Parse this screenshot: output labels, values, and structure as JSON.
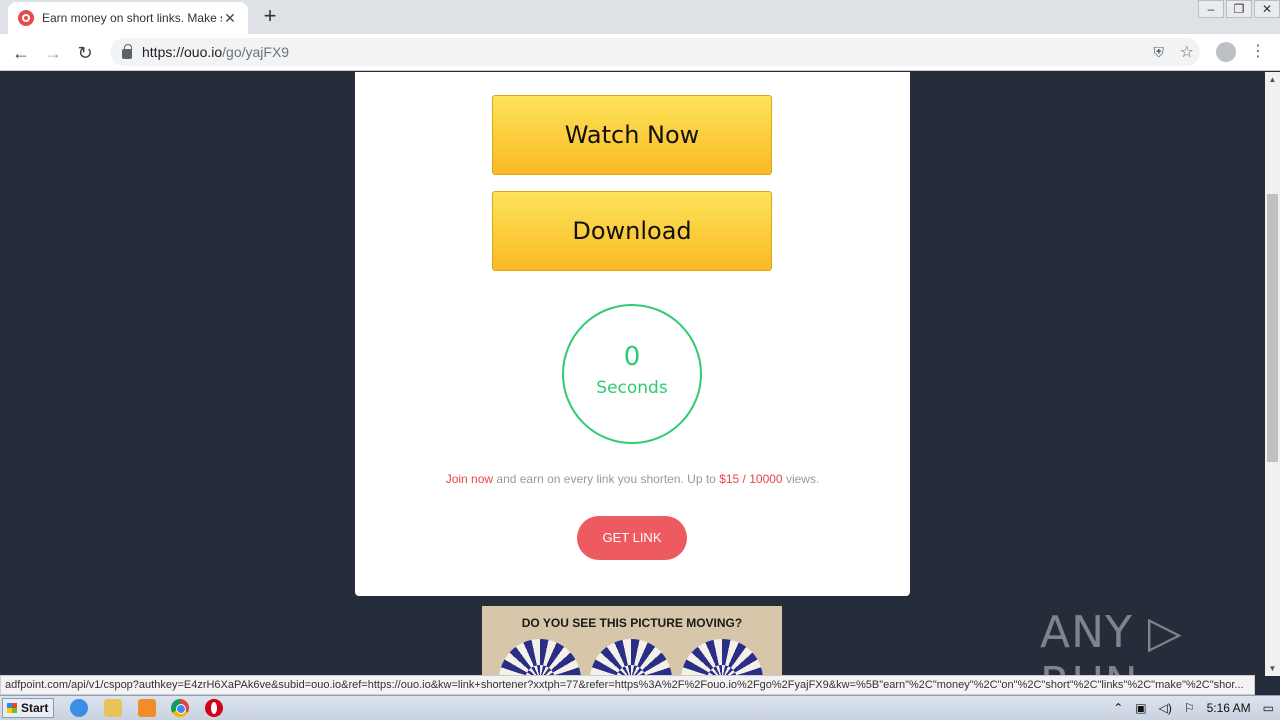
{
  "browser": {
    "tab_title": "Earn money on short links. Make sho",
    "tab_close": "✕",
    "new_tab": "+",
    "url_host": "https://ouo.io",
    "url_path": "/go/yajFX9",
    "window_controls": [
      "–",
      "❐",
      "✕"
    ]
  },
  "page": {
    "watch_now_label": "Watch Now",
    "download_label": "Download",
    "countdown_value": "0",
    "countdown_unit": "Seconds",
    "promo_join": "Join now",
    "promo_mid": " and earn on every link you shorten. Up to ",
    "promo_amount": "$15 / 10000",
    "promo_end": " views.",
    "get_link_label": "GET LINK",
    "ad_question": "DO YOU SEE THIS PICTURE MOVING?"
  },
  "watermark": "ANY ▷ RUN",
  "status_url": "adfpoint.com/api/v1/cspop?authkey=E4zrH6XaPAk6ve&subid=ouo.io&ref=https://ouo.io&kw=link+shortener?xxtph=77&refer=https%3A%2F%2Fouo.io%2Fgo%2FyajFX9&kw=%5B\"earn\"%2C\"money\"%2C\"on\"%2C\"short\"%2C\"links\"%2C\"make\"%2C\"shor...",
  "taskbar": {
    "start_label": "Start",
    "clock": "5:16 AM"
  },
  "colors": {
    "page_bg": "#252d3a",
    "button_yellow": "#fbb924",
    "countdown_green": "#2ecc71",
    "accent_red": "#ed5a5f"
  }
}
